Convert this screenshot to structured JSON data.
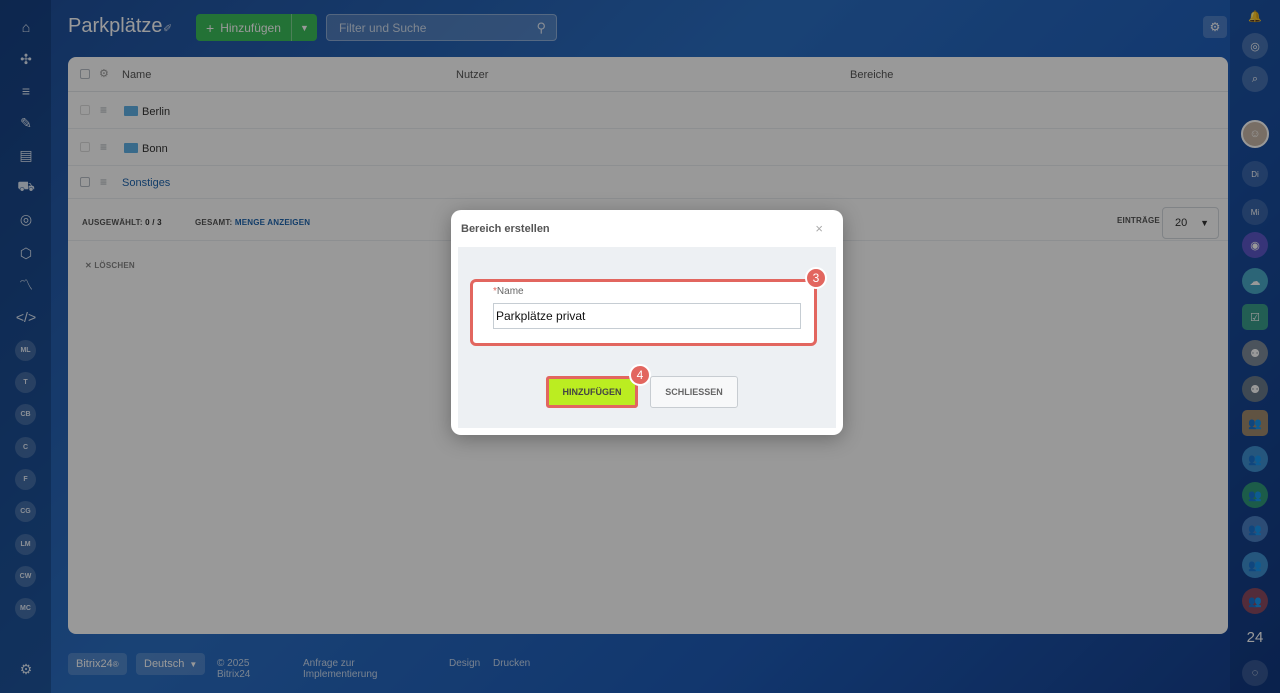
{
  "left_nav": {
    "icons": [
      "home-icon",
      "puzzle-icon",
      "funnel-icon",
      "pen-icon",
      "newsletter-icon",
      "cart-icon",
      "target-icon",
      "box-icon",
      "marketing-icon",
      "code-icon"
    ],
    "circles": [
      "ML",
      "T",
      "CB",
      "C",
      "F",
      "CG",
      "LM",
      "CW",
      "MC"
    ]
  },
  "header": {
    "title": "Parkplätze",
    "add_button": "Hinzufügen",
    "search_placeholder": "Filter und Suche"
  },
  "grid": {
    "columns": {
      "name": "Name",
      "users": "Nutzer",
      "areas": "Bereiche"
    },
    "rows": [
      {
        "name": "Berlin",
        "folder": true
      },
      {
        "name": "Bonn",
        "folder": true
      },
      {
        "name": "Sonstiges",
        "folder": false
      }
    ],
    "footer": {
      "selected_label": "AUSGEWÄHLT:",
      "selected_value": "0 / 3",
      "total_label": "GESAMT:",
      "total_link": "MENGE ANZEIGEN",
      "entries_label": "EINTRÄGE",
      "entries_value": "20"
    },
    "delete_label": "LÖSCHEN"
  },
  "dialog": {
    "title": "Bereich erstellen",
    "field_label": "Name",
    "field_value": "Parkplätze privat",
    "add_button": "HINZUFÜGEN",
    "close_button": "SCHLIESSEN",
    "badge_field": "3",
    "badge_button": "4"
  },
  "right_nav": {
    "items": [
      "Di",
      "Mi"
    ],
    "counter": "24"
  },
  "footer": {
    "brand": "Bitrix24",
    "language": "Deutsch",
    "copyright": "© 2025 Bitrix24",
    "links": [
      "Anfrage zur Implementierung",
      "Design",
      "Drucken"
    ]
  },
  "colors": {
    "accent_green": "#3bbf5a",
    "highlight_red": "#e2665f",
    "lime_button": "#bbed21"
  }
}
